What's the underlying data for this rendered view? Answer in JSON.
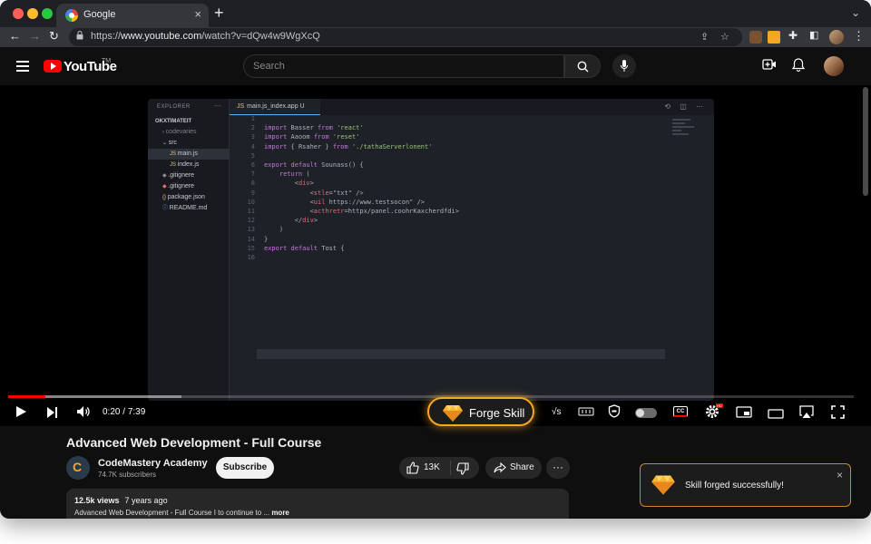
{
  "browser": {
    "tab_title": "Google",
    "tab_close": "×",
    "new_tab": "+",
    "url_prefix": "https://",
    "url_host": "www.youtube.com",
    "url_path": "/watch?v=dQw4w9WgXcQ"
  },
  "youtube": {
    "logo_text": "YouTube",
    "logo_tm": "TM",
    "search_placeholder": "Search"
  },
  "editor": {
    "explorer_title": "EXPLORER",
    "explorer_dots": "···",
    "tree": [
      {
        "label": "OKXTIMATEIT",
        "indent": 0
      },
      {
        "label": "codevaries",
        "indent": 1
      },
      {
        "label": "src",
        "indent": 1
      },
      {
        "label": "main.js",
        "indent": 2
      },
      {
        "label": "index.js",
        "indent": 2
      },
      {
        "label": ".gitignere",
        "indent": 1
      },
      {
        "label": ".gitignere",
        "indent": 1
      },
      {
        "label": "package.json",
        "indent": 1
      },
      {
        "label": "README.md",
        "indent": 1
      }
    ],
    "tab_label": "main.js_index.app U",
    "line_numbers": [
      "1",
      "2",
      "3",
      "4",
      "5",
      "6",
      "7",
      "8",
      "9",
      "10",
      "11",
      "12",
      "13",
      "14",
      "15",
      "16"
    ],
    "code_lines": [
      "",
      "import Basser from 'react'",
      "import Aaoom from 'reset'",
      "import { Rsaher } from './tathaServerlonent'",
      "",
      "export default Sounass() {",
      "    return (",
      "        <div>",
      "            <stle=\"txt\" />",
      "            <uil https://www.testsocon\" />",
      "            <acthretr=httpx/panel.coohrKaxcherdfdi>",
      "        </div>",
      "    )",
      "}",
      "export default Tost {",
      ""
    ]
  },
  "player": {
    "time_current": "0:20",
    "time_total": "7:39",
    "time_separator": " / ",
    "progress_played": 0.044,
    "progress_buffered": 0.205,
    "forge_label": "Forge Skill",
    "partial_label": "√s",
    "hd_badge": "HD",
    "cc_label": "CC"
  },
  "video": {
    "title": "Advanced Web Development - Full Course",
    "channel_name": "CodeMastery Academy",
    "subscribers": "74.7K subscribers",
    "subscribe_label": "Subscribe",
    "likes": "13K",
    "share_label": "Share",
    "more_label": "···",
    "views": "12.5k views",
    "uploaded": "7 years ago",
    "description": "Advanced Web Development - Full Course  I to continue to ...",
    "more_link": "more"
  },
  "toast": {
    "message": "Skill forged successfully!",
    "close": "×"
  },
  "colors": {
    "accent_gold": "#f5a623",
    "youtube_red": "#ff0000"
  }
}
